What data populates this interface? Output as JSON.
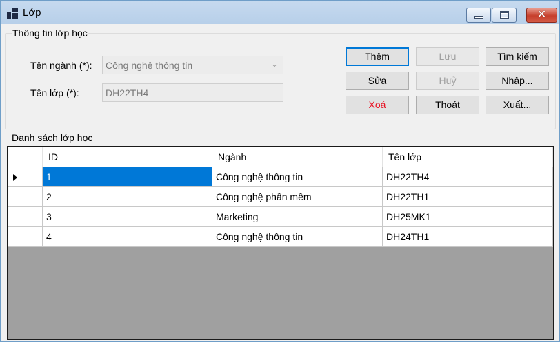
{
  "window": {
    "title": "Lớp",
    "icon": "app-window-icon"
  },
  "form": {
    "group_title": "Thông tin lớp học",
    "nganh_label": "Tên ngành (*):",
    "nganh_value": "Công nghệ thông tin",
    "lop_label": "Tên lớp (*):",
    "lop_value": "DH22TH4"
  },
  "buttons": {
    "them": "Thêm",
    "luu": "Lưu",
    "tim_kiem": "Tìm kiếm",
    "sua": "Sửa",
    "huy": "Huỷ",
    "nhap": "Nhập...",
    "xoa": "Xoá",
    "thoat": "Thoát",
    "xuat": "Xuất..."
  },
  "grid": {
    "title": "Danh sách lớp học",
    "columns": [
      "ID",
      "Ngành",
      "Tên lớp"
    ],
    "rows": [
      {
        "id": "1",
        "nganh": "Công nghệ thông tin",
        "ten_lop": "DH22TH4"
      },
      {
        "id": "2",
        "nganh": "Công nghệ phần mềm",
        "ten_lop": "DH22TH1"
      },
      {
        "id": "3",
        "nganh": "Marketing",
        "ten_lop": "DH25MK1"
      },
      {
        "id": "4",
        "nganh": "Công nghệ thông tin",
        "ten_lop": "DH24TH1"
      }
    ],
    "selected_row": 0
  },
  "colors": {
    "selection": "#0078d7",
    "delete_text": "#e81123",
    "grid_background": "#a0a0a0"
  }
}
